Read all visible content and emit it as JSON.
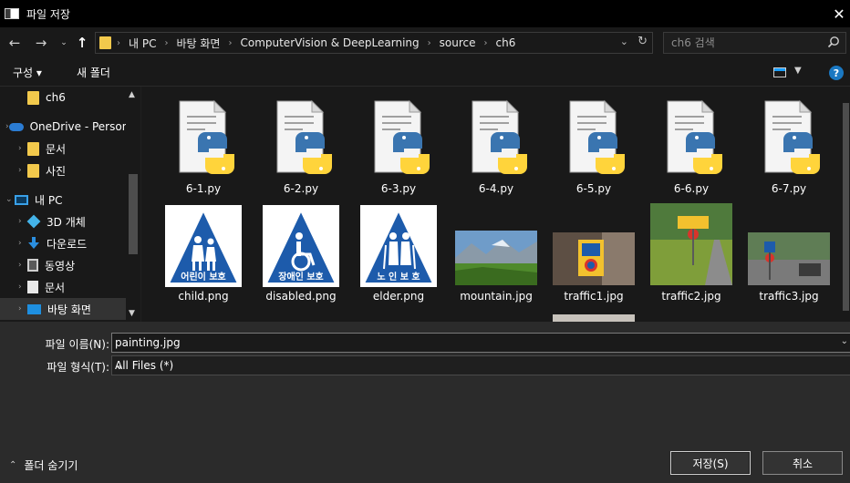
{
  "window": {
    "title": "파일 저장"
  },
  "address": {
    "crumbs": [
      "내 PC",
      "바탕 화면",
      "ComputerVision & DeepLearning",
      "source",
      "ch6"
    ]
  },
  "search": {
    "placeholder": "ch6 검색"
  },
  "toolbar": {
    "organize": "구성 ▾",
    "new_folder": "새 폴더",
    "help": "?"
  },
  "nav": {
    "items": [
      {
        "label": "ch6",
        "icon": "folder-icon"
      },
      {
        "label": "OneDrive - Personal",
        "icon": "cloud-icon"
      },
      {
        "label": "문서",
        "icon": "folder-icon"
      },
      {
        "label": "사진",
        "icon": "folder-icon"
      },
      {
        "label": "내 PC",
        "icon": "pc-icon"
      },
      {
        "label": "3D 개체",
        "icon": "cube-icon"
      },
      {
        "label": "다운로드",
        "icon": "download-icon"
      },
      {
        "label": "동영상",
        "icon": "video-icon"
      },
      {
        "label": "문서",
        "icon": "document-icon"
      },
      {
        "label": "바탕 화면",
        "icon": "desktop-icon"
      }
    ]
  },
  "files": {
    "python": [
      "6-1.py",
      "6-2.py",
      "6-3.py",
      "6-4.py",
      "6-5.py",
      "6-6.py",
      "6-7.py"
    ],
    "signs": [
      {
        "name": "child.png",
        "sign_text": "어린이 보호"
      },
      {
        "name": "disabled.png",
        "sign_text": "장애인 보호"
      },
      {
        "name": "elder.png",
        "sign_text": "노 인 보 호"
      }
    ],
    "photos": [
      "mountain.jpg",
      "traffic1.jpg",
      "traffic2.jpg",
      "traffic3.jpg"
    ]
  },
  "form": {
    "filename_label": "파일 이름(N):",
    "filename_value": "painting.jpg",
    "filetype_label": "파일 형식(T):",
    "filetype_value": "All Files (*)"
  },
  "footer": {
    "hide_folders": "폴더 숨기기",
    "save": "저장(S)",
    "cancel": "취소"
  },
  "colors": {
    "accent": "#1a78c2",
    "folder": "#f2c94c",
    "sign_blue": "#1d5bab"
  }
}
